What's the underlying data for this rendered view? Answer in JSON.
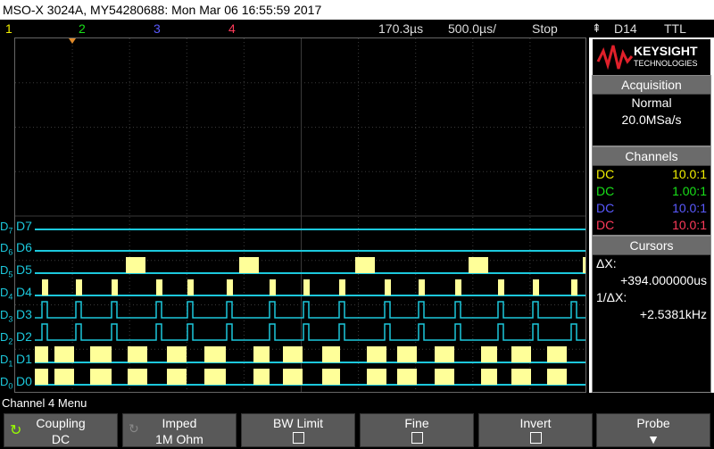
{
  "title": "MSO-X 3024A, MY54280688: Mon Mar 06 16:55:59 2017",
  "status": {
    "ch1": "1",
    "ch2": "2",
    "ch3": "3",
    "ch4": "4",
    "delay": "170.3µs",
    "timebase": "500.0µs/",
    "run_state": "Stop",
    "trigger_src": "D14",
    "trigger_level": "TTL"
  },
  "logo": {
    "brand": "KEYSIGHT",
    "sub": "TECHNOLOGIES"
  },
  "acquisition": {
    "header": "Acquisition",
    "mode": "Normal",
    "rate": "20.0MSa/s"
  },
  "channels": {
    "header": "Channels",
    "rows": [
      {
        "coupling": "DC",
        "probe": "10.0:1",
        "color": "#f2f000"
      },
      {
        "coupling": "DC",
        "probe": "1.00:1",
        "color": "#19e019"
      },
      {
        "coupling": "DC",
        "probe": "10.0:1",
        "color": "#5a5aff"
      },
      {
        "coupling": "DC",
        "probe": "10.0:1",
        "color": "#ff3a5a"
      }
    ]
  },
  "cursors": {
    "header": "Cursors",
    "dx_label": "ΔX:",
    "dx_value": "+394.000000us",
    "inv_label": "1/ΔX:",
    "inv_value": "+2.5381kHz"
  },
  "digital": [
    {
      "sub": "7",
      "name": "D7"
    },
    {
      "sub": "6",
      "name": "D6"
    },
    {
      "sub": "5",
      "name": "D5"
    },
    {
      "sub": "4",
      "name": "D4"
    },
    {
      "sub": "3",
      "name": "D3"
    },
    {
      "sub": "2",
      "name": "D2"
    },
    {
      "sub": "1",
      "name": "D1"
    },
    {
      "sub": "0",
      "name": "D0"
    }
  ],
  "menu_title": "Channel 4 Menu",
  "softkeys": [
    {
      "label": "Coupling",
      "value": "DC"
    },
    {
      "label": "Imped",
      "value": "1M Ohm"
    },
    {
      "label": "BW Limit",
      "value": ""
    },
    {
      "label": "Fine",
      "value": ""
    },
    {
      "label": "Invert",
      "value": ""
    },
    {
      "label": "Probe",
      "value": ""
    }
  ],
  "colors": {
    "digital_trace": "#1cc8dc",
    "digital_fill": "#ffff99",
    "grid": "#3a3a3a"
  }
}
